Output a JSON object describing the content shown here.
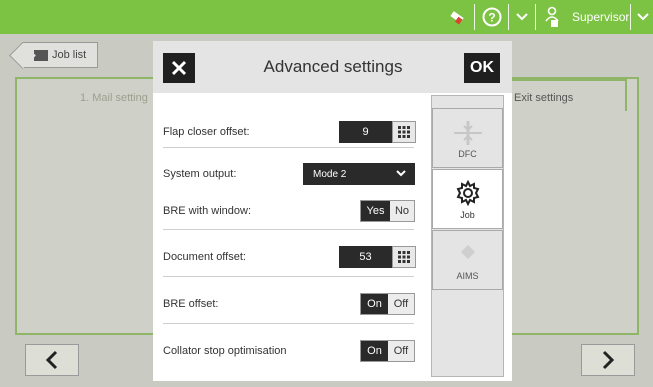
{
  "topbar": {
    "user_label": "Supervisor",
    "accent_color": "#7cc243",
    "icons": [
      "eraser-icon",
      "help-icon",
      "chevron-down-icon",
      "user-icon",
      "chevron-down-icon"
    ]
  },
  "background": {
    "joblist_label": "Job list",
    "tab_1": "1. Mail setting",
    "tab_exit": "Exit settings"
  },
  "dialog": {
    "title": "Advanced settings",
    "ok_label": "OK",
    "rows": {
      "flap_closer": {
        "label": "Flap closer offset:",
        "value": "9"
      },
      "system_output": {
        "label": "System output:",
        "value": "Mode 2"
      },
      "bre_window": {
        "label": "BRE with window:",
        "on": "Yes",
        "off": "No"
      },
      "document_offset": {
        "label": "Document offset:",
        "value": "53"
      },
      "bre_offset": {
        "label": "BRE offset:",
        "on": "On",
        "off": "Off"
      },
      "collator_stop": {
        "label": "Collator stop optimisation",
        "on": "On",
        "off": "Off"
      }
    },
    "tabs": [
      {
        "label": "DFC",
        "icon": "dfc-icon"
      },
      {
        "label": "Job",
        "icon": "gear-icon",
        "active": true
      },
      {
        "label": "AIMS",
        "icon": "aims-icon"
      }
    ]
  }
}
